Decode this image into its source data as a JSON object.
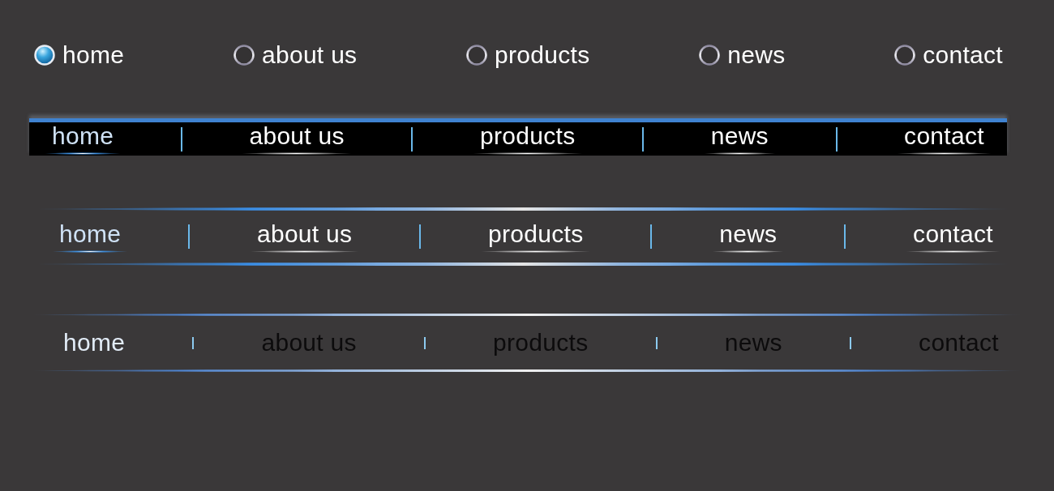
{
  "menus": [
    {
      "kind": "radio",
      "items": [
        {
          "label": "home",
          "selected": true
        },
        {
          "label": "about us",
          "selected": false
        },
        {
          "label": "products",
          "selected": false
        },
        {
          "label": "news",
          "selected": false
        },
        {
          "label": "contact",
          "selected": false
        }
      ]
    },
    {
      "kind": "black-bar",
      "items": [
        {
          "label": "home",
          "selected": true
        },
        {
          "label": "about us",
          "selected": false
        },
        {
          "label": "products",
          "selected": false
        },
        {
          "label": "news",
          "selected": false
        },
        {
          "label": "contact",
          "selected": false
        }
      ]
    },
    {
      "kind": "glow-lines",
      "items": [
        {
          "label": "home",
          "selected": true
        },
        {
          "label": "about us",
          "selected": false
        },
        {
          "label": "products",
          "selected": false
        },
        {
          "label": "news",
          "selected": false
        },
        {
          "label": "contact",
          "selected": false
        }
      ]
    },
    {
      "kind": "thin-lines",
      "items": [
        {
          "label": "home",
          "selected": true
        },
        {
          "label": "about us",
          "selected": false
        },
        {
          "label": "products",
          "selected": false
        },
        {
          "label": "news",
          "selected": false
        },
        {
          "label": "contact",
          "selected": false
        }
      ]
    }
  ]
}
